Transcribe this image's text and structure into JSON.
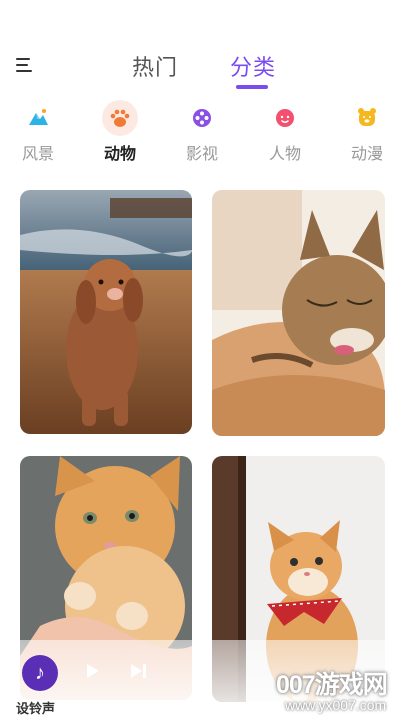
{
  "header": {
    "tabs": [
      {
        "label": "热门",
        "active": false
      },
      {
        "label": "分类",
        "active": true
      }
    ],
    "accent_color": "#7a4cf0"
  },
  "categories": [
    {
      "label": "风景",
      "icon": "mountain-icon",
      "active": false
    },
    {
      "label": "动物",
      "icon": "paw-icon",
      "active": true
    },
    {
      "label": "影视",
      "icon": "film-reel-icon",
      "active": false
    },
    {
      "label": "人物",
      "icon": "face-icon",
      "active": false
    },
    {
      "label": "动漫",
      "icon": "bear-icon",
      "active": false
    }
  ],
  "wallpapers": [
    {
      "subject": "dog-photo"
    },
    {
      "subject": "sleeping-cat-photo"
    },
    {
      "subject": "kitten-photo"
    },
    {
      "subject": "cat-with-scarf-photo"
    }
  ],
  "player": {
    "ringtone_label": "设铃声",
    "button_color": "#5a2fb5"
  },
  "watermark": {
    "text": "007游戏网",
    "url": "www.yx007.com"
  }
}
